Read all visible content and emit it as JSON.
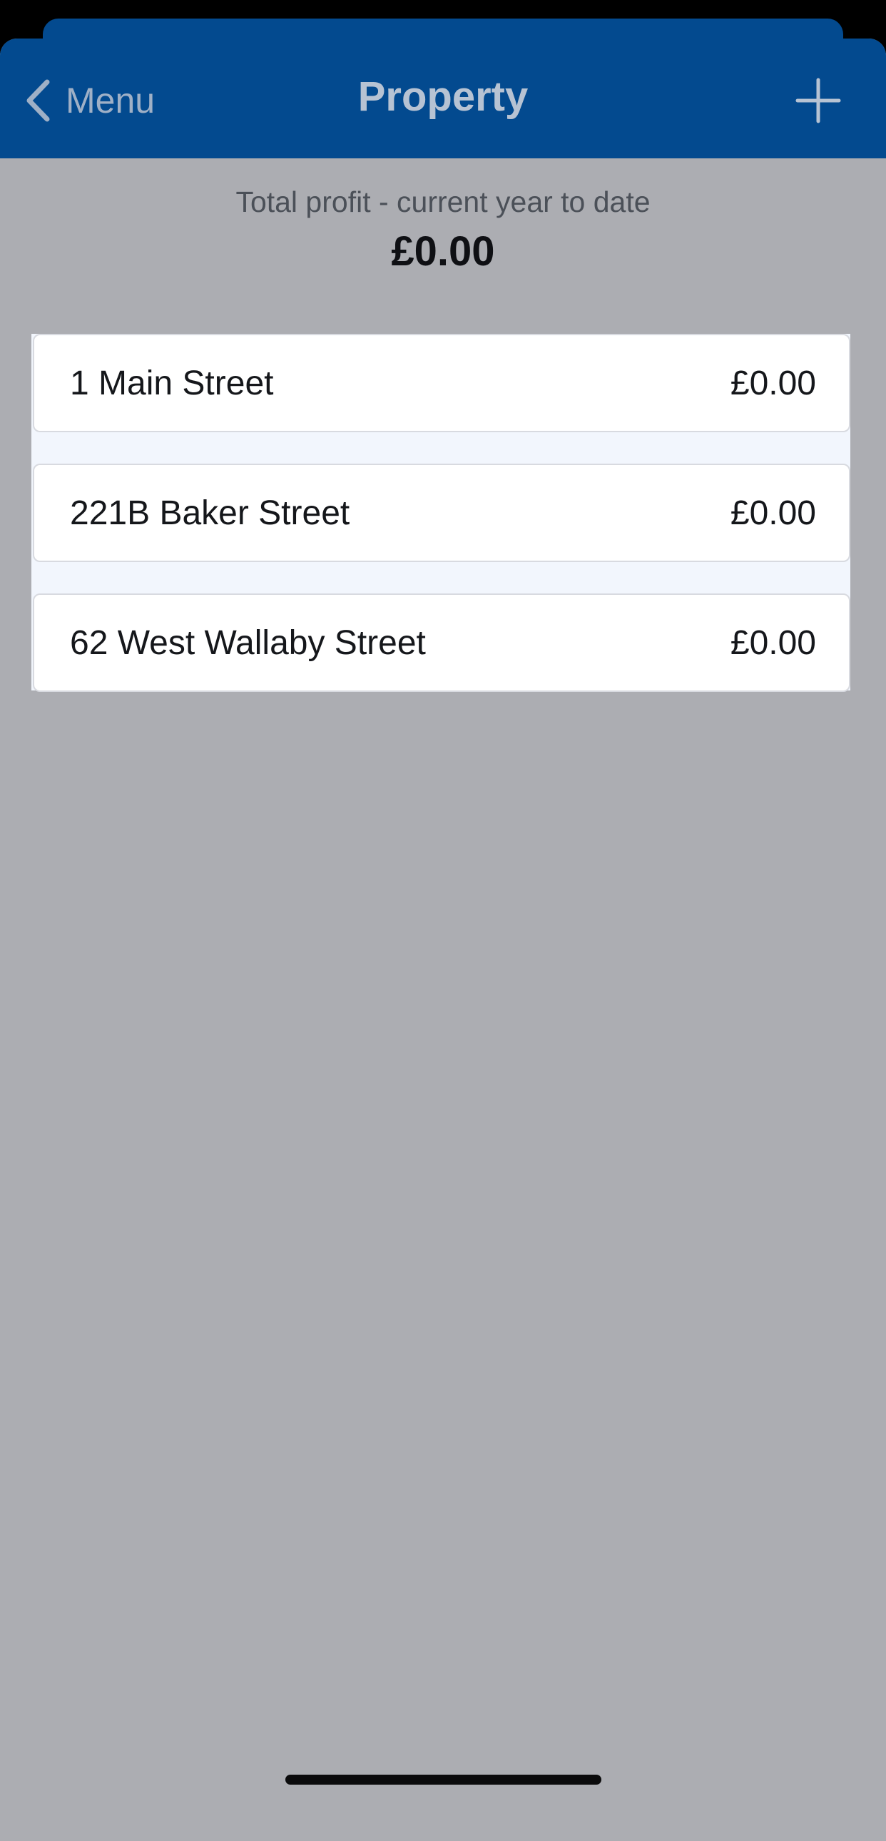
{
  "nav": {
    "back_label": "Menu",
    "title": "Property",
    "back_icon": "chevron-left-icon",
    "add_icon": "plus-icon"
  },
  "summary": {
    "label": "Total profit - current year to date",
    "value": "£0.00"
  },
  "properties": [
    {
      "name": "1 Main Street",
      "amount": "£0.00"
    },
    {
      "name": "221B Baker Street",
      "amount": "£0.00"
    },
    {
      "name": "62 West Wallaby Street",
      "amount": "£0.00"
    }
  ],
  "colors": {
    "nav_background": "#034a8f",
    "screen_background": "#acadb2",
    "list_background": "#f2f6fd"
  }
}
